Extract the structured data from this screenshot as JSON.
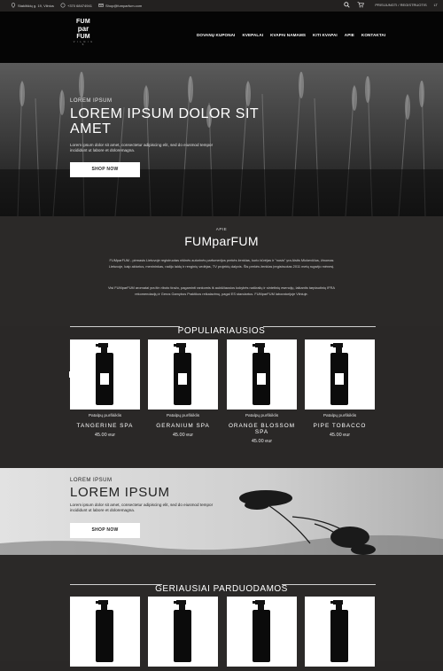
{
  "topbar": {
    "address": "Stakliškių g. 19, Vilnius",
    "phone": "+370 68474941",
    "email": "Shop@fumparfum.com",
    "login": "PRISIJUNGTI / REGISTRUOTIS",
    "language": "LT"
  },
  "logo": {
    "top": "Vilnius",
    "line1": "FUM",
    "line2": "par",
    "line3": "FUM",
    "bottom": "V I L N I U S"
  },
  "nav": [
    "DOVANŲ KUPONAI",
    "KVEPALAI",
    "KVAPAI NAMAMS",
    "KITI KVAPAI",
    "APIE",
    "KONTAKTAI"
  ],
  "hero": {
    "kicker": "LOREM IPSUM",
    "title": "LOREM IPSUM DOLOR SIT AMET",
    "text": "Lorem ipsum dolor sit amet, consectetur adipiscing elit, sed do eiusmod tempor incididunt ut labore et doloremagna.",
    "button": "SHOP NOW"
  },
  "about": {
    "kicker": "APIE",
    "title": "FUMparFUM",
    "text1": "FUMparFUM - pirmasis Lietuvoje registruotas nišinės autorinės parfumerijos prekės ženklas, kurio kūrėjas ir \"nosis\" yra Aistis Mickevičius, žinomas Lietuvoje, kaip aktorius, menininkas, radijo laidų ir renginių vedėjas, TV projektų dalyvis. Šis prekės ženklas įregistruotas 2011 metų rugsėjo mėnesį.",
    "text2": "Visi FUMparFUM aromatai yra itin riboto tiražo, pagaminti rankomis iš aukščiausios kokybės natūralių ir sintetinių esencijų, laikantis tarptautinių IFRA rekomendacijų ir Geros Gamybos Praktikos reikalavimų, pagal ES standartus. FUMparFUM laboratorijoje Vilniuje."
  },
  "popular": {
    "title": "POPULIARIAUSIOS",
    "products": [
      {
        "category": "Patalpų purškiklis",
        "name": "TANGERINE SPA",
        "price": "45.00 eur"
      },
      {
        "category": "Patalpų purškiklis",
        "name": "GERANIUM SPA",
        "price": "45.00 eur"
      },
      {
        "category": "Patalpų purškiklis",
        "name": "ORANGE BLOSSOM SPA",
        "price": "45.00 eur"
      },
      {
        "category": "Patalpų purškiklis",
        "name": "PIPE TOBACCO",
        "price": "45.00 eur"
      }
    ]
  },
  "banner": {
    "kicker": "LOREM IPSUM",
    "title": "LOREM IPSUM",
    "text": "Lorem ipsum dolor sit amet, consectetur adipiscing elit, sed do eiusmod tempor incididunt ut labore et doloremagna.",
    "button": "SHOP NOW"
  },
  "bestsellers": {
    "title": "GERIAUSIAI PARDUODAMOS"
  },
  "icons": {
    "location": "location-icon",
    "phone": "phone-icon",
    "mail": "mail-icon",
    "search": "search-icon",
    "cart": "cart-icon",
    "prev": "chevron-left-icon",
    "next": "chevron-right-icon"
  }
}
